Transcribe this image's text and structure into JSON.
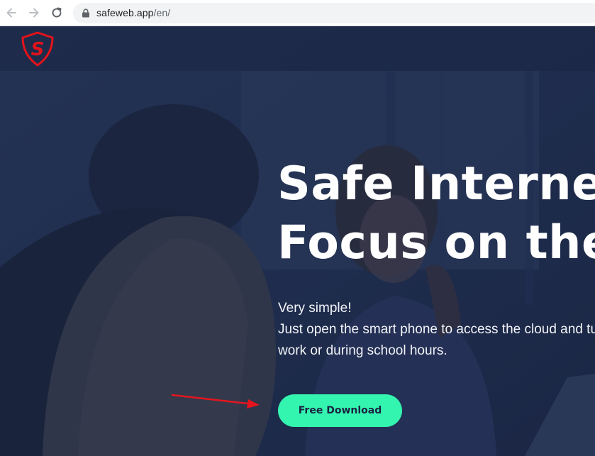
{
  "browser": {
    "url_host": "safeweb.app",
    "url_path": "/en/",
    "icons": [
      "back-arrow-icon",
      "forward-arrow-icon",
      "reload-icon",
      "lock-icon"
    ]
  },
  "site": {
    "logo_letter": "S",
    "brand_color": "#e2131b"
  },
  "hero": {
    "headline_lines": [
      "Safe Internet",
      "Focus on the"
    ],
    "tagline_lines": [
      "Very simple!",
      "Just open the smart phone to access the cloud and tu",
      "work or during school hours."
    ],
    "cta_label": "Free Download",
    "cta_color": "#34f5b0",
    "annotation_color": "#e5151f"
  }
}
